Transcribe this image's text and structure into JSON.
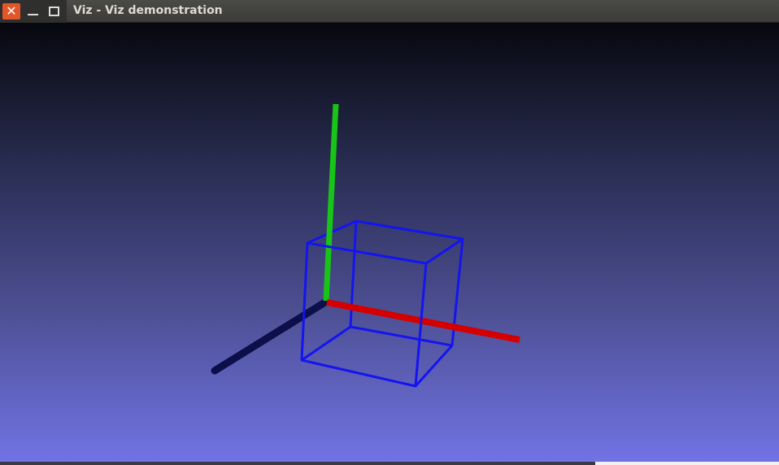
{
  "window": {
    "title": "Viz - Viz demonstration",
    "close_glyph": "✕"
  },
  "icons": {
    "close": "close-icon",
    "minimize": "minimize-icon",
    "maximize": "maximize-icon"
  },
  "colors": {
    "close_button": "#e2562a",
    "x_axis": "#d40000",
    "y_axis": "#18c418",
    "z_axis": "#0c0f4a",
    "cube": "#1414f0",
    "background_top": "#07070f",
    "background_bottom": "#7274e6"
  }
}
